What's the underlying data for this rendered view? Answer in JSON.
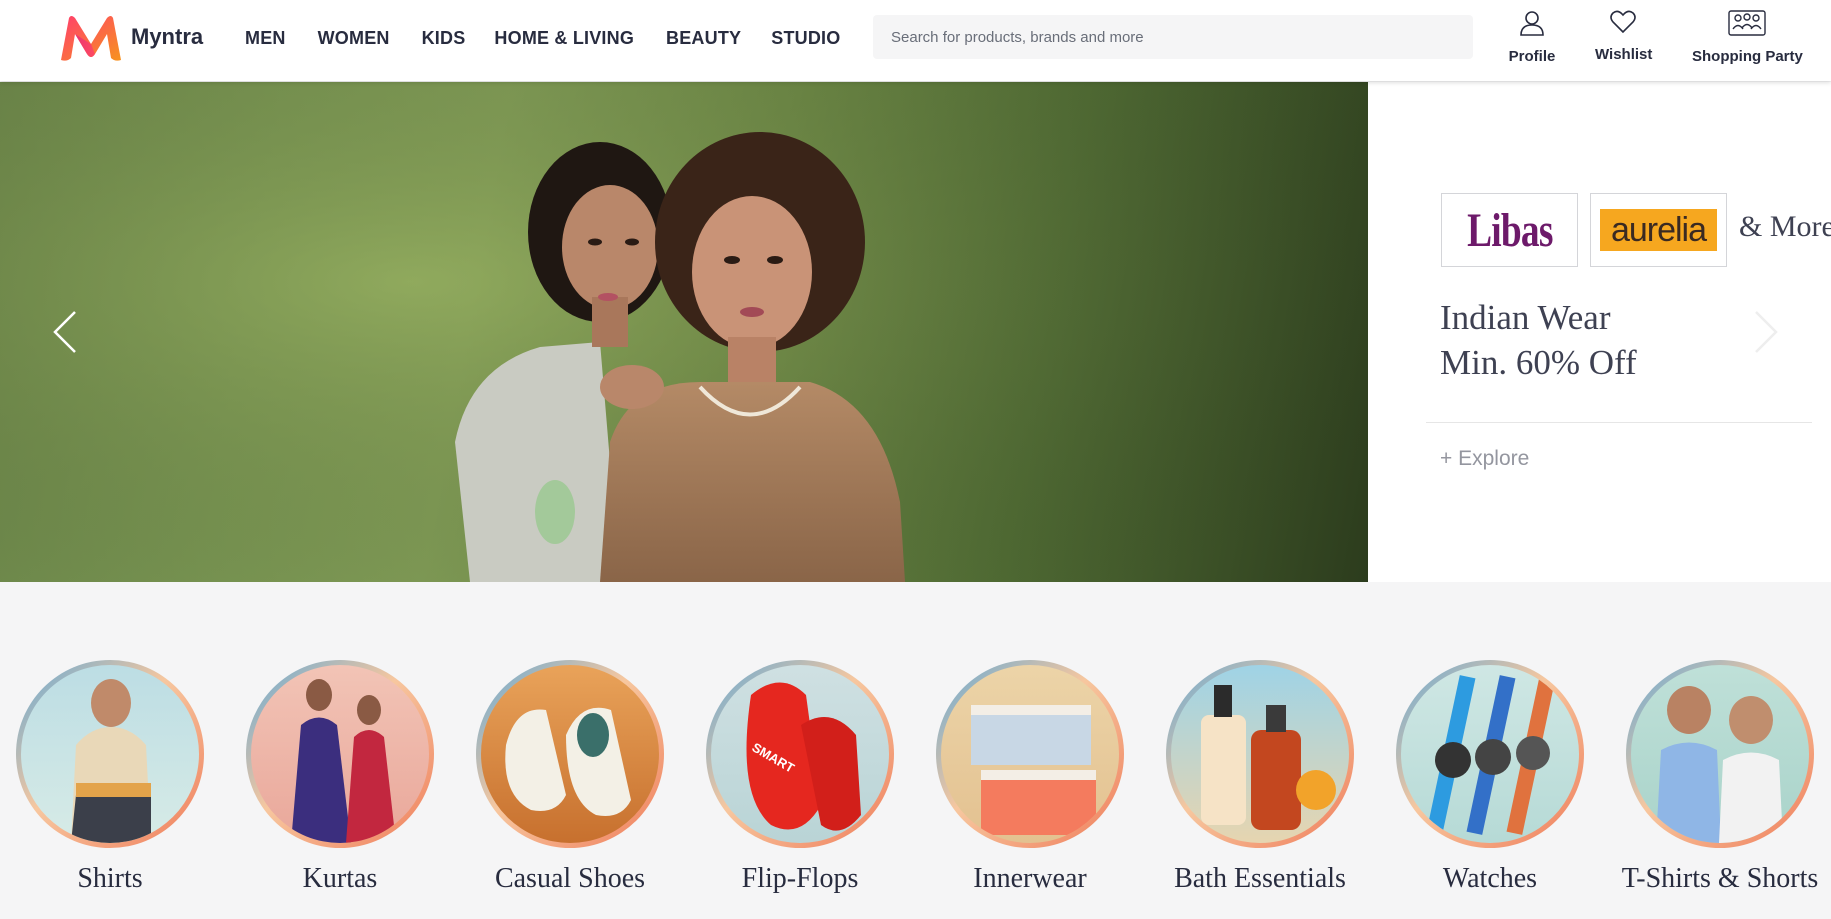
{
  "app": {
    "logo_text": "Myntra"
  },
  "nav": {
    "items": [
      {
        "label": "MEN",
        "name": "nav-men"
      },
      {
        "label": "WOMEN",
        "name": "nav-women"
      },
      {
        "label": "KIDS",
        "name": "nav-kids"
      },
      {
        "label": "HOME & LIVING",
        "name": "nav-home-living"
      },
      {
        "label": "BEAUTY",
        "name": "nav-beauty"
      },
      {
        "label": "STUDIO",
        "name": "nav-studio"
      }
    ]
  },
  "search": {
    "placeholder": "Search for products, brands and more",
    "value": ""
  },
  "header_actions": {
    "profile": {
      "label": "Profile",
      "icon": "user-icon"
    },
    "wishlist": {
      "label": "Wishlist",
      "icon": "heart-icon"
    },
    "party": {
      "label": "Shopping Party",
      "icon": "group-icon"
    }
  },
  "hero": {
    "brands": [
      "Libas",
      "aurelia"
    ],
    "brands_suffix": "& More",
    "title_line1": "Indian Wear",
    "title_line2": "Min. 60% Off",
    "cta": "+ Explore",
    "prev_icon": "chevron-left-icon",
    "next_icon": "chevron-right-icon"
  },
  "categories": [
    {
      "label": "Shirts"
    },
    {
      "label": "Kurtas"
    },
    {
      "label": "Casual Shoes"
    },
    {
      "label": "Flip-Flops"
    },
    {
      "label": "Innerwear"
    },
    {
      "label": "Bath Essentials"
    },
    {
      "label": "Watches"
    },
    {
      "label": "T-Shirts & Shorts"
    }
  ],
  "colors": {
    "logo_pink": "#ff3f6c",
    "logo_orange": "#f7931e",
    "libas_purple": "#6d1a6a",
    "aurelia_orange": "#f6a71f",
    "text_dark": "#282c3f"
  }
}
